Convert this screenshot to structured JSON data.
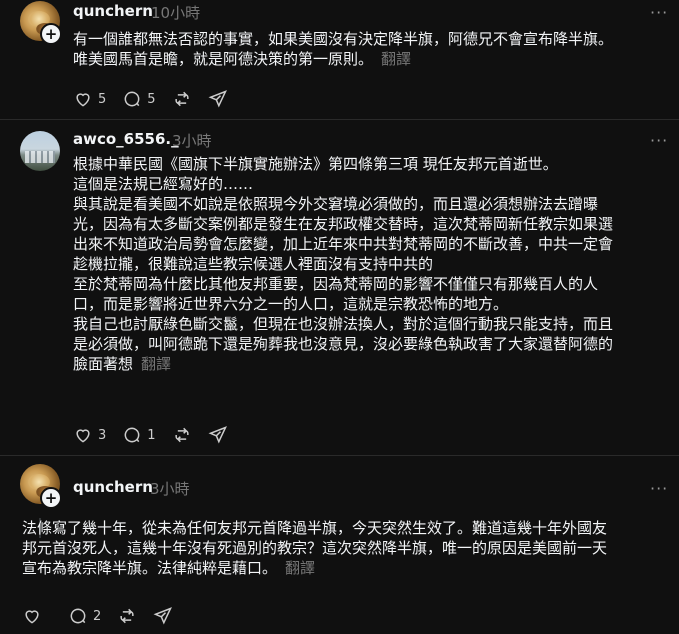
{
  "posts": [
    {
      "username": "qunchern",
      "time": "10小時",
      "lines": [
        "有一個誰都無法否認的事實，如果美國沒有決定降半旗，阿德兄不會宣布降半旗。",
        "唯美國馬首是瞻，就是阿德決策的第一原則。"
      ],
      "translate": "翻譯",
      "likes": "5",
      "replies": "5"
    },
    {
      "username": "awco_6556._",
      "time": "3小時",
      "lines": [
        "根據中華民國《國旗下半旗實施辦法》第四條第三項 現任友邦元首逝世。",
        "這個是法規已經寫好的……",
        "與其說是看美國不如說是依照現今外交窘境必須做的，而且還必須想辦法去蹭曝",
        "光，因為有太多斷交案例都是發生在友邦政權交替時，這次梵蒂岡新任教宗如果選",
        "出來不知道政治局勢會怎麼變，加上近年來中共對梵蒂岡的不斷改善，中共一定會",
        "趁機拉攏，很難說這些教宗候選人裡面沒有支持中共的",
        "至於梵蒂岡為什麼比其他友邦重要，因為梵蒂岡的影響不僅僅只有那幾百人的人",
        "口，而是影響將近世界六分之一的人口，這就是宗教恐怖的地方。",
        "我自己也討厭綠色斷交鬣，但現在也沒辦法換人，對於這個行動我只能支持，而且",
        "是必須做，叫阿德跪下還是殉葬我也沒意見，沒必要綠色執政害了大家還替阿德的",
        "臉面著想"
      ],
      "translate": "翻譯",
      "likes": "3",
      "replies": "1"
    },
    {
      "username": "qunchern",
      "time": "3小時",
      "lines": [
        "法條寫了幾十年，從未為任何友邦元首降過半旗，今天突然生效了。難道這幾十年外國友",
        "邦元首沒死人，這幾十年沒有死過別的教宗？這次突然降半旗，唯一的原因是美國前一天",
        "宣布為教宗降半旗。法律純粹是藉口。"
      ],
      "translate": "翻譯",
      "replies": "2"
    }
  ],
  "icons": {
    "like": "heart-icon",
    "reply": "comment-icon",
    "repost": "repost-icon",
    "share": "share-icon",
    "more": "more-icon",
    "follow": "plus-icon"
  }
}
